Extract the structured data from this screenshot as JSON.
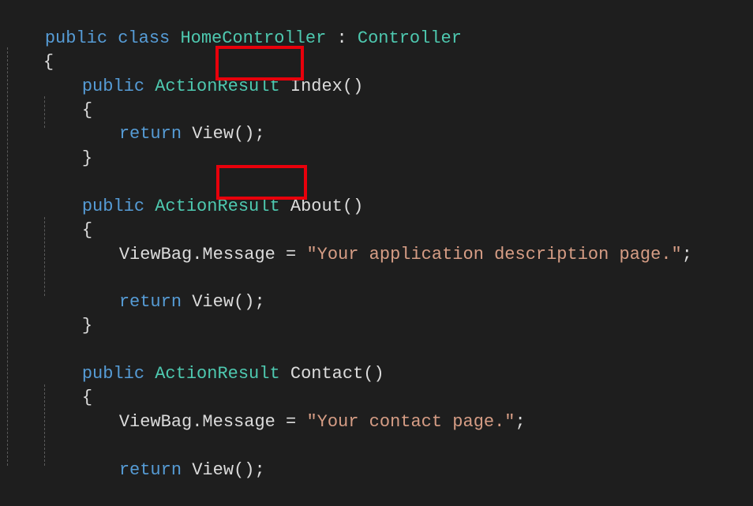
{
  "code": {
    "class_decl": {
      "kw": "public class ",
      "name": "HomeController",
      "sep": " : ",
      "base": "Controller"
    },
    "open_class": "{",
    "index": {
      "sig_kw": "public ",
      "sig_type": "ActionResult",
      "sig_name": "Index()",
      "open": "{",
      "ret_kw": "return ",
      "ret_call": "View();",
      "close": "}"
    },
    "about": {
      "sig_kw": "public ",
      "sig_type": "ActionResult",
      "sig_name": "About()",
      "open": "{",
      "msg_lhs": "ViewBag.Message = ",
      "msg_str": "\"Your application description page.\"",
      "msg_end": ";",
      "ret_kw": "return ",
      "ret_call": "View();",
      "close": "}"
    },
    "contact": {
      "sig_kw": "public ",
      "sig_type": "ActionResult",
      "sig_name": "Contact()",
      "open": "{",
      "msg_lhs": "ViewBag.Message = ",
      "msg_str": "\"Your contact page.\"",
      "msg_end": ";",
      "ret_kw": "return ",
      "ret_call": "View();"
    }
  },
  "colors": {
    "background": "#1e1e1e",
    "keyword": "#569cd6",
    "type": "#4ec9b0",
    "string": "#d69d85",
    "text": "#dcdcdc",
    "highlight_box": "#e8000b"
  }
}
